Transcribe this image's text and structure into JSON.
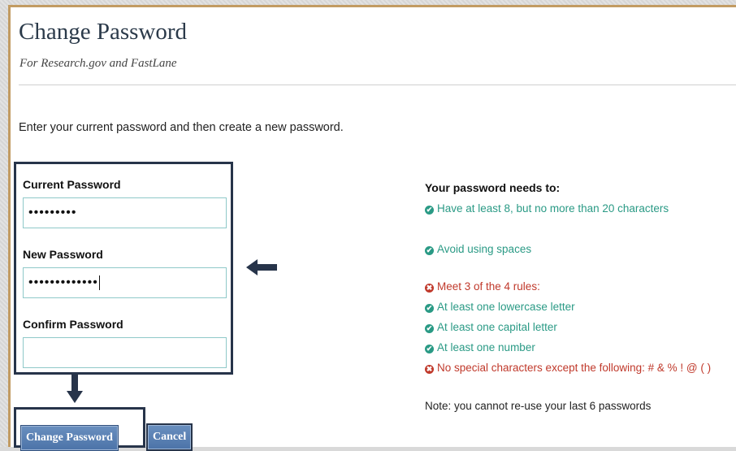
{
  "header": {
    "title": "Change Password",
    "subtitle": "For Research.gov and FastLane"
  },
  "intro": "Enter your current password and then create a new password.",
  "form": {
    "current": {
      "label": "Current Password",
      "value": "•••••••••"
    },
    "new": {
      "label": "New Password",
      "value": "•••••••••••••"
    },
    "confirm": {
      "label": "Confirm Password",
      "value": ""
    }
  },
  "buttons": {
    "change": "Change Password",
    "cancel": "Cancel"
  },
  "requirements": {
    "title": "Your password needs to:",
    "items": [
      {
        "text": "Have at least 8, but no more than 20 characters",
        "status": "ok"
      },
      {
        "text": "Avoid using spaces",
        "status": "ok"
      },
      {
        "text": "Meet 3 of the 4 rules:",
        "status": "fail"
      },
      {
        "text": "At least one lowercase letter",
        "status": "ok"
      },
      {
        "text": "At least one capital letter",
        "status": "ok"
      },
      {
        "text": "At least one number",
        "status": "ok"
      },
      {
        "text": "No special characters except the following: # & % ! @ ( )",
        "status": "fail"
      }
    ],
    "note": "Note: you cannot re-use your last 6 passwords"
  },
  "colors": {
    "ok": "#2a9a85",
    "fail": "#c0392b",
    "accent_border": "#c29b62",
    "button": "#5b7fb1"
  },
  "icons": {
    "ok": "check-circle-icon",
    "fail": "x-circle-icon",
    "annotation": "arrow-icon"
  }
}
